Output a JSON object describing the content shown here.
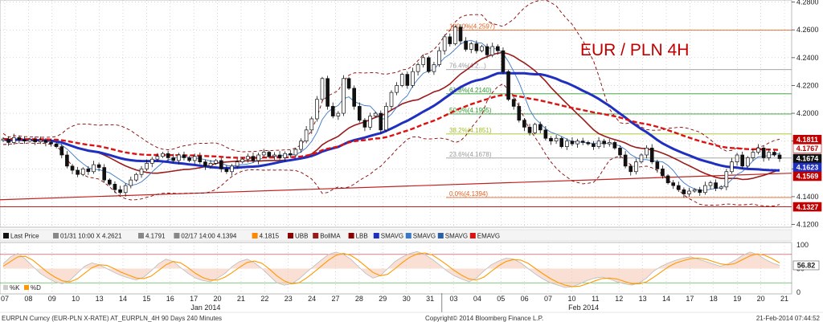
{
  "chart_data": {
    "type": "candlestick",
    "title": "EUR / PLN 4H",
    "colors": {
      "title": "#c00000",
      "band": "#8b0000",
      "bollma": "#9b1b1b",
      "smavg_fast": "#3a78c8",
      "smavg_slow": "#1f2fbf",
      "emavg": "#dd1111",
      "fib": "#e06020",
      "up": "#ffffff",
      "down": "#111111",
      "grid": "#999999"
    },
    "y_axis": {
      "ticks": [
        "4.2800",
        "4.2600",
        "4.2400",
        "4.2200",
        "4.2000",
        "4.1800",
        "4.1600",
        "4.1400",
        "4.1200"
      ],
      "ylim": [
        4.118,
        4.2815
      ]
    },
    "x_axis": {
      "ticks": [
        "07",
        "08",
        "09",
        "10",
        "13",
        "14",
        "15",
        "16",
        "17",
        "20",
        "21",
        "22",
        "23",
        "24",
        "27",
        "28",
        "29",
        "30",
        "31",
        "03",
        "04",
        "05",
        "06",
        "07",
        "10",
        "11",
        "12",
        "13",
        "14",
        "17",
        "18",
        "19",
        "20",
        "21"
      ],
      "month_labels": [
        "Jan 2014",
        "Feb 2014"
      ]
    },
    "price_labels": [
      {
        "text": "4.1811",
        "value": 4.1811,
        "bg": "#c00000",
        "fg": "#ffffff"
      },
      {
        "text": "4.1767",
        "value": 4.1767,
        "bg": "#ffffff",
        "fg": "#c00000"
      },
      {
        "text": "4.1674",
        "value": 4.1674,
        "bg": "#111111",
        "fg": "#ffffff"
      },
      {
        "text": "4.1623",
        "value": 4.1623,
        "bg": "#1f2fbf",
        "fg": "#ffffff"
      },
      {
        "text": "4.1569",
        "value": 4.1569,
        "bg": "#c00000",
        "fg": "#ffffff"
      },
      {
        "text": "4.1327",
        "value": 4.1327,
        "bg": "#c00000",
        "fg": "#ffffff"
      }
    ],
    "fib_levels": [
      {
        "label": "100.0%(4.2597)",
        "value": 4.2597,
        "color": "#e06020"
      },
      {
        "label": "76.4%(4.2...)",
        "value": 4.2314,
        "color": "#999999"
      },
      {
        "label": "61.8%(4.2140)",
        "value": 4.214,
        "color": "#2e9a2e"
      },
      {
        "label": "50.0%(4.1995)",
        "value": 4.1995,
        "color": "#2e9a2e"
      },
      {
        "label": "38.2%(4.1851)",
        "value": 4.1851,
        "color": "#a0c020"
      },
      {
        "label": "23.6%(4.1678)",
        "value": 4.1678,
        "color": "#999999"
      },
      {
        "label": "0.0%(4.1394)",
        "value": 4.1394,
        "color": "#e06020"
      }
    ],
    "trendline_value": {
      "start": 4.1394,
      "end": 4.1569
    },
    "support_value": 4.1327,
    "candles_close": [
      4.1815,
      4.179,
      4.1825,
      4.181,
      4.18,
      4.1812,
      4.1795,
      4.1805,
      4.179,
      4.178,
      4.176,
      4.17,
      4.162,
      4.159,
      4.156,
      4.16,
      4.158,
      4.163,
      4.161,
      4.152,
      4.149,
      4.145,
      4.143,
      4.148,
      4.152,
      4.156,
      4.16,
      4.164,
      4.167,
      4.169,
      4.171,
      4.168,
      4.166,
      4.17,
      4.168,
      4.166,
      4.169,
      4.165,
      4.162,
      4.164,
      4.166,
      4.16,
      4.158,
      4.162,
      4.165,
      4.167,
      4.169,
      4.166,
      4.17,
      4.172,
      4.169,
      4.17,
      4.168,
      4.171,
      4.17,
      4.174,
      4.18,
      4.188,
      4.196,
      4.21,
      4.225,
      4.205,
      4.198,
      4.2,
      4.225,
      4.218,
      4.205,
      4.195,
      4.19,
      4.198,
      4.2,
      4.188,
      4.205,
      4.215,
      4.22,
      4.228,
      4.22,
      4.23,
      4.235,
      4.24,
      4.23,
      4.235,
      4.245,
      4.255,
      4.25,
      4.262,
      4.252,
      4.246,
      4.25,
      4.245,
      4.248,
      4.242,
      4.248,
      4.245,
      4.23,
      4.21,
      4.205,
      4.195,
      4.19,
      4.186,
      4.192,
      4.188,
      4.182,
      4.18,
      4.182,
      4.176,
      4.18,
      4.178,
      4.18,
      4.179,
      4.178,
      4.176,
      4.18,
      4.178,
      4.179,
      4.175,
      4.17,
      4.162,
      4.158,
      4.165,
      4.17,
      4.175,
      4.165,
      4.16,
      4.155,
      4.15,
      4.148,
      4.145,
      4.142,
      4.144,
      4.145,
      4.143,
      4.148,
      4.15,
      4.146,
      4.147,
      4.158,
      4.165,
      4.17,
      4.162,
      4.168,
      4.172,
      4.175,
      4.168,
      4.172,
      4.17,
      4.1674
    ],
    "legend": [
      {
        "name": "Last Price",
        "color": "#111111"
      },
      {
        "name": "01/31 10:00 X 4.2621",
        "color": "#888888"
      },
      {
        "name": "4.1791",
        "color": "#888888"
      },
      {
        "name": "02/17 14:00 4.1394",
        "color": "#888888"
      },
      {
        "name": "4.1815",
        "color": "#ff8800"
      },
      {
        "name": "UBB",
        "color": "#8b0000"
      },
      {
        "name": "BollMA",
        "color": "#9b1b1b"
      },
      {
        "name": "LBB",
        "color": "#8b0000"
      },
      {
        "name": "SMAVG",
        "color": "#1f2fbf"
      },
      {
        "name": "SMAVG",
        "color": "#3a78c8"
      },
      {
        "name": "SMAVG",
        "color": "#2a5fa8"
      },
      {
        "name": "EMAVG",
        "color": "#dd1111"
      }
    ],
    "oscillator": {
      "ticks": [
        "100",
        "50",
        "0"
      ],
      "ylim": [
        0,
        100
      ],
      "value_label": "56.82",
      "mini_legend": [
        {
          "name": "%K",
          "color": "#cccccc"
        },
        {
          "name": "%D",
          "color": "#ff9900"
        }
      ],
      "k_values": [
        60,
        75,
        82,
        70,
        55,
        40,
        30,
        22,
        18,
        25,
        40,
        55,
        62,
        58,
        50,
        42,
        35,
        30,
        26,
        32,
        45,
        60,
        70,
        65,
        52,
        40,
        30,
        25,
        22,
        30,
        40,
        55,
        65,
        70,
        62,
        50,
        35,
        20,
        15,
        18,
        28,
        42,
        55,
        68,
        80,
        85,
        80,
        70,
        55,
        40,
        30,
        35,
        50,
        65,
        75,
        82,
        86,
        80,
        70,
        58,
        45,
        35,
        28,
        22,
        30,
        45,
        58,
        66,
        72,
        70,
        62,
        50,
        38,
        28,
        20,
        15,
        10,
        12,
        18,
        25,
        30,
        32,
        28,
        22,
        18,
        15,
        20,
        30,
        45,
        55,
        62,
        68,
        72,
        75,
        70,
        65,
        60,
        55,
        60,
        68,
        78,
        85,
        80,
        70,
        62,
        56.82
      ],
      "d_values": [
        55,
        65,
        75,
        76,
        68,
        55,
        42,
        32,
        24,
        22,
        28,
        40,
        52,
        58,
        57,
        50,
        42,
        36,
        30,
        29,
        34,
        46,
        58,
        65,
        62,
        52,
        40,
        31,
        26,
        26,
        32,
        42,
        53,
        63,
        66,
        61,
        49,
        35,
        24,
        18,
        20,
        30,
        42,
        55,
        68,
        78,
        82,
        78,
        68,
        55,
        42,
        35,
        38,
        50,
        63,
        74,
        81,
        83,
        79,
        69,
        58,
        46,
        36,
        28,
        26,
        32,
        44,
        56,
        65,
        69,
        68,
        61,
        50,
        39,
        29,
        21,
        15,
        12,
        13,
        18,
        24,
        29,
        30,
        28,
        23,
        18,
        18,
        22,
        32,
        43,
        54,
        62,
        67,
        71,
        72,
        70,
        65,
        60,
        58,
        61,
        69,
        77,
        81,
        78,
        71,
        62
      ]
    },
    "footer": {
      "left": "EURPLN Curncy (EUR-PLN X-RATE) AT_EURPLN_4H 90 Days 240 Minutes",
      "center": "Copyright© 2014 Bloomberg Finance L.P.",
      "right": "21-Feb-2014 07:44:52"
    }
  }
}
